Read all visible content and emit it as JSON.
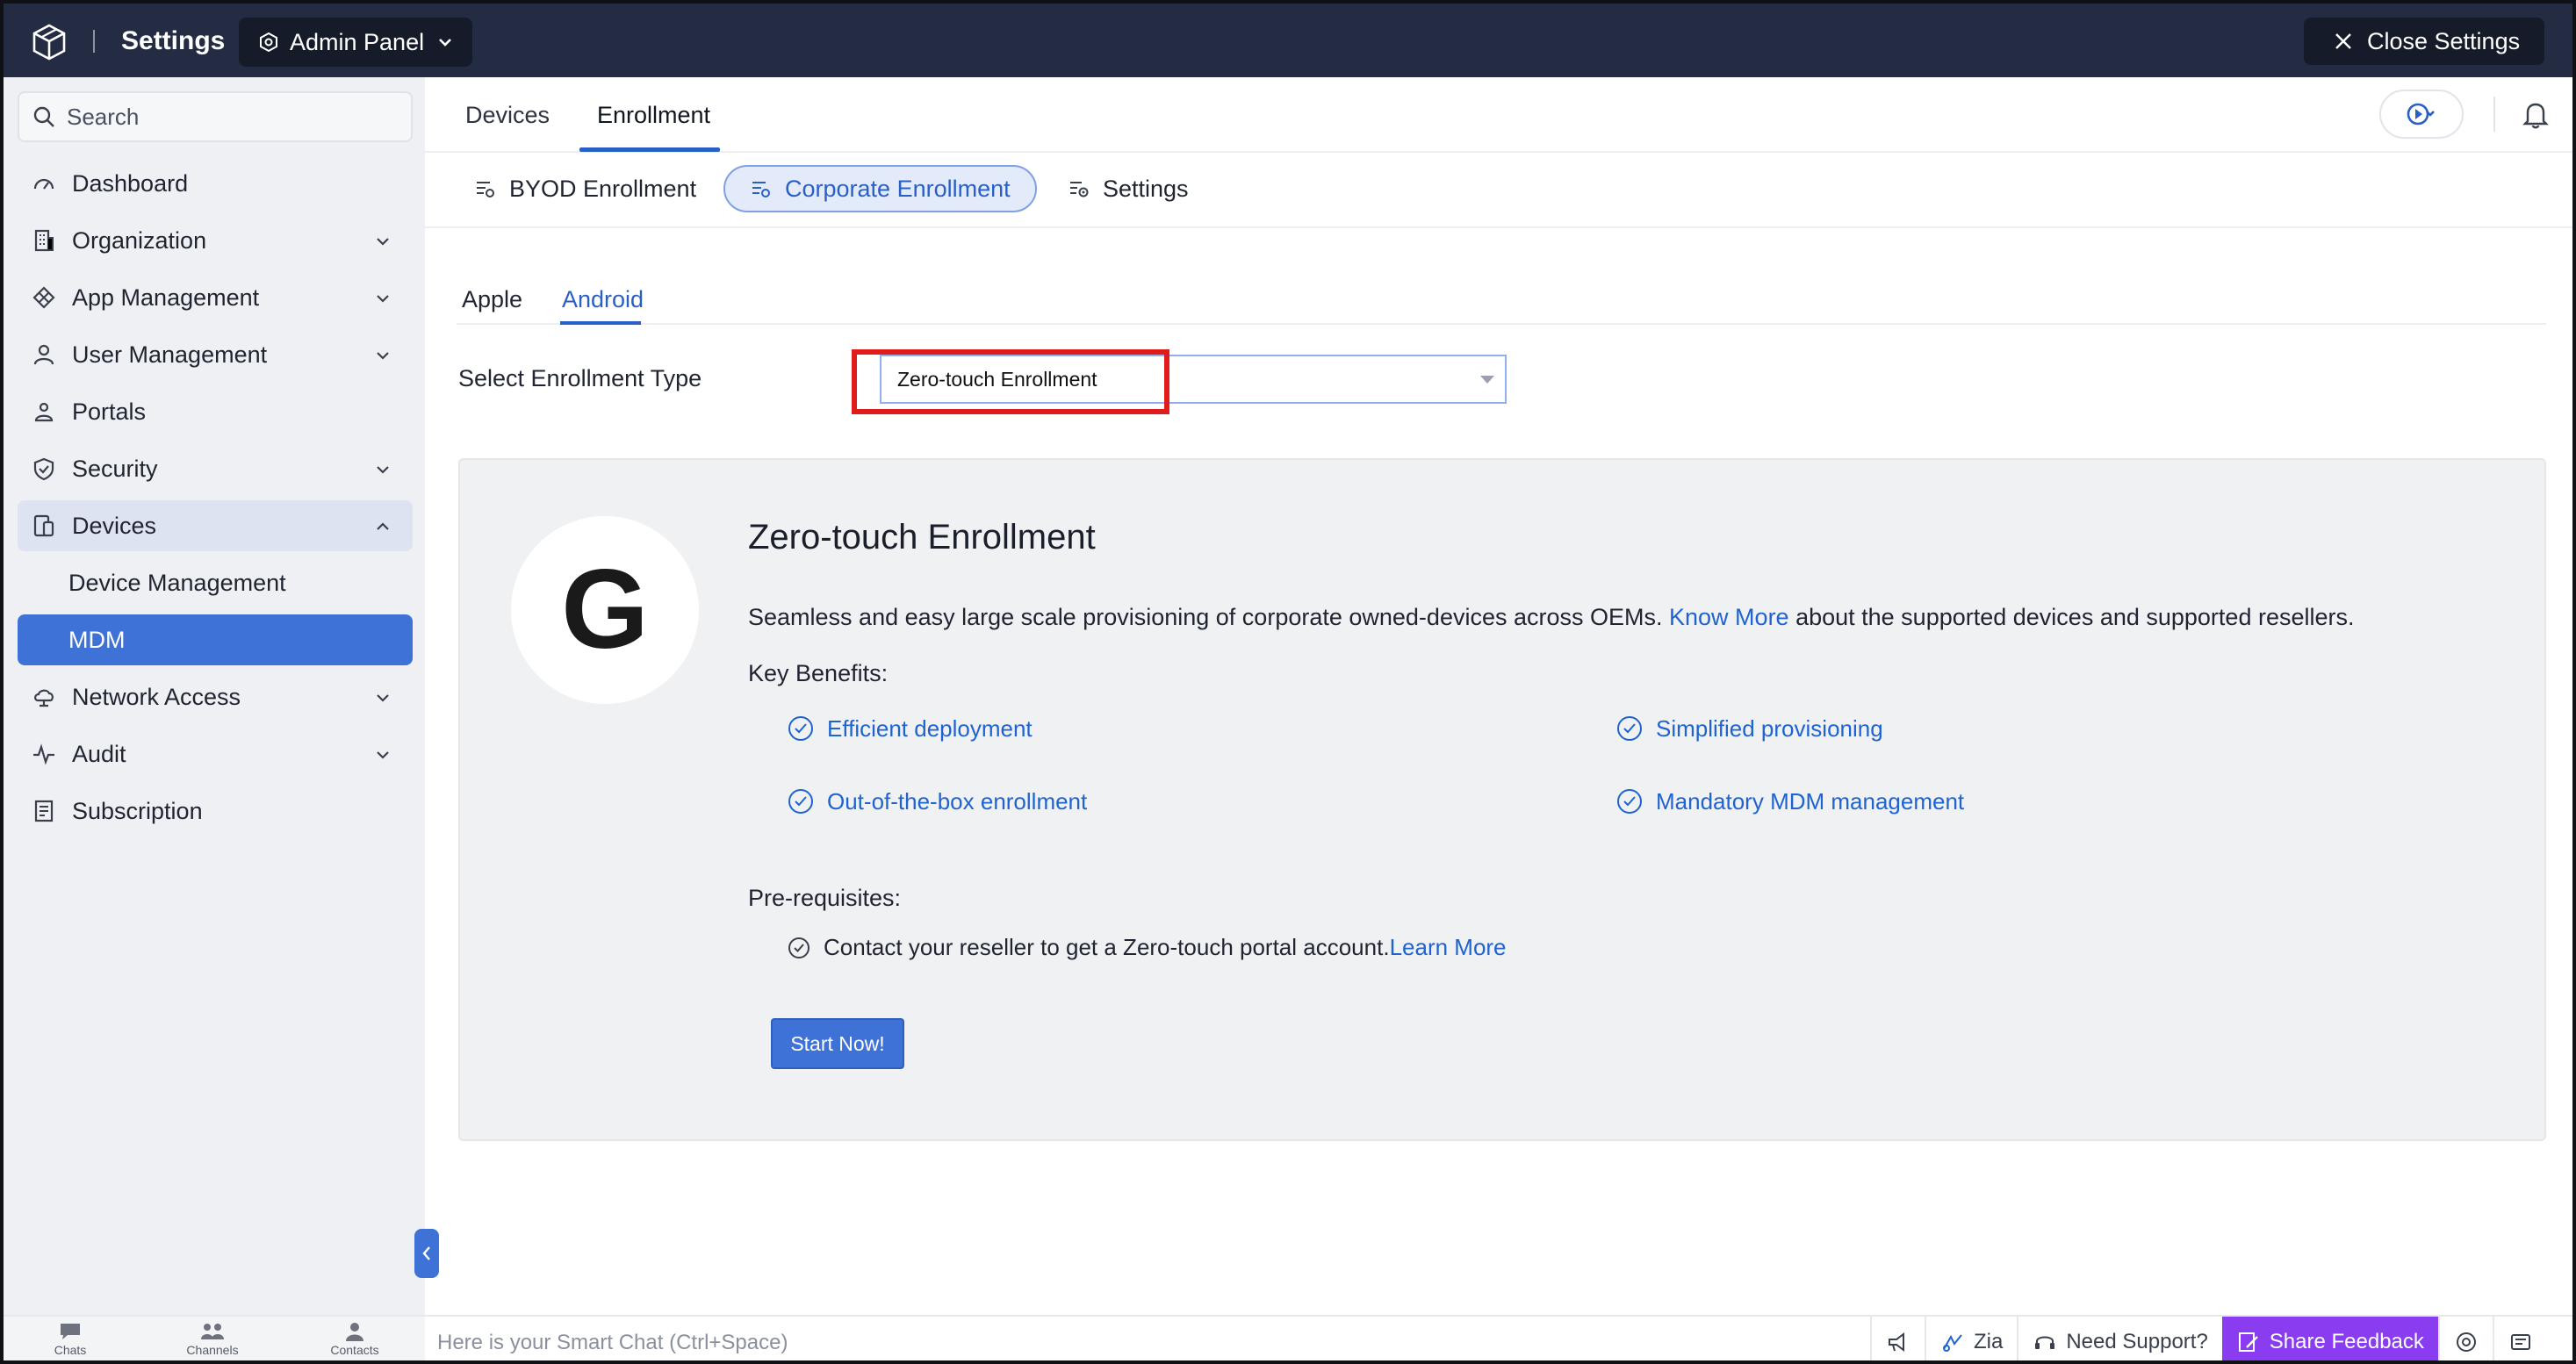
{
  "topbar": {
    "app_title": "Settings",
    "admin_panel_label": "Admin Panel",
    "close_label": "Close Settings"
  },
  "sidebar": {
    "search_placeholder": "Search",
    "items": [
      {
        "label": "Dashboard",
        "icon": "dashboard-icon"
      },
      {
        "label": "Organization",
        "icon": "organization-icon"
      },
      {
        "label": "App Management",
        "icon": "app-management-icon"
      },
      {
        "label": "User Management",
        "icon": "user-icon"
      },
      {
        "label": "Portals",
        "icon": "portals-icon"
      },
      {
        "label": "Security",
        "icon": "shield-icon"
      },
      {
        "label": "Devices",
        "icon": "devices-icon"
      },
      {
        "label": "Network Access",
        "icon": "cloud-icon"
      },
      {
        "label": "Audit",
        "icon": "pulse-icon"
      },
      {
        "label": "Subscription",
        "icon": "subscription-icon"
      }
    ],
    "devices_sub": [
      "Device Management",
      "MDM"
    ]
  },
  "main": {
    "tabs": [
      "Devices",
      "Enrollment"
    ],
    "subtabs": [
      "BYOD Enrollment",
      "Corporate Enrollment",
      "Settings"
    ],
    "os_tabs": [
      "Apple",
      "Android"
    ],
    "enrollment_type_label": "Select Enrollment Type",
    "enrollment_type_value": "Zero-touch Enrollment"
  },
  "card": {
    "title": "Zero-touch Enrollment",
    "desc_before": "Seamless and easy large scale provisioning of corporate owned-devices across OEMs. ",
    "desc_link": "Know More",
    "desc_after": " about the supported devices and supported resellers.",
    "key_benefits_label": "Key Benefits:",
    "benefits": [
      "Efficient deployment",
      "Simplified provisioning",
      "Out-of-the-box enrollment",
      "Mandatory MDM management"
    ],
    "prereq_label": "Pre-requisites:",
    "prereq_text": "Contact your reseller to get a Zero-touch portal account. ",
    "prereq_link": "Learn More",
    "start_button": "Start Now!",
    "logo_letter": "G"
  },
  "bottombar": {
    "items": [
      "Chats",
      "Channels",
      "Contacts"
    ],
    "smart_chat_placeholder": "Here is your Smart Chat (Ctrl+Space)",
    "zia": "Zia",
    "support": "Need Support?",
    "share_feedback": "Share Feedback"
  },
  "colors": {
    "topbar": "#242c44",
    "accent": "#3f72d6",
    "link": "#1f63d1",
    "highlight": "#e01b1b",
    "share_feedback": "#8a3cf0"
  }
}
